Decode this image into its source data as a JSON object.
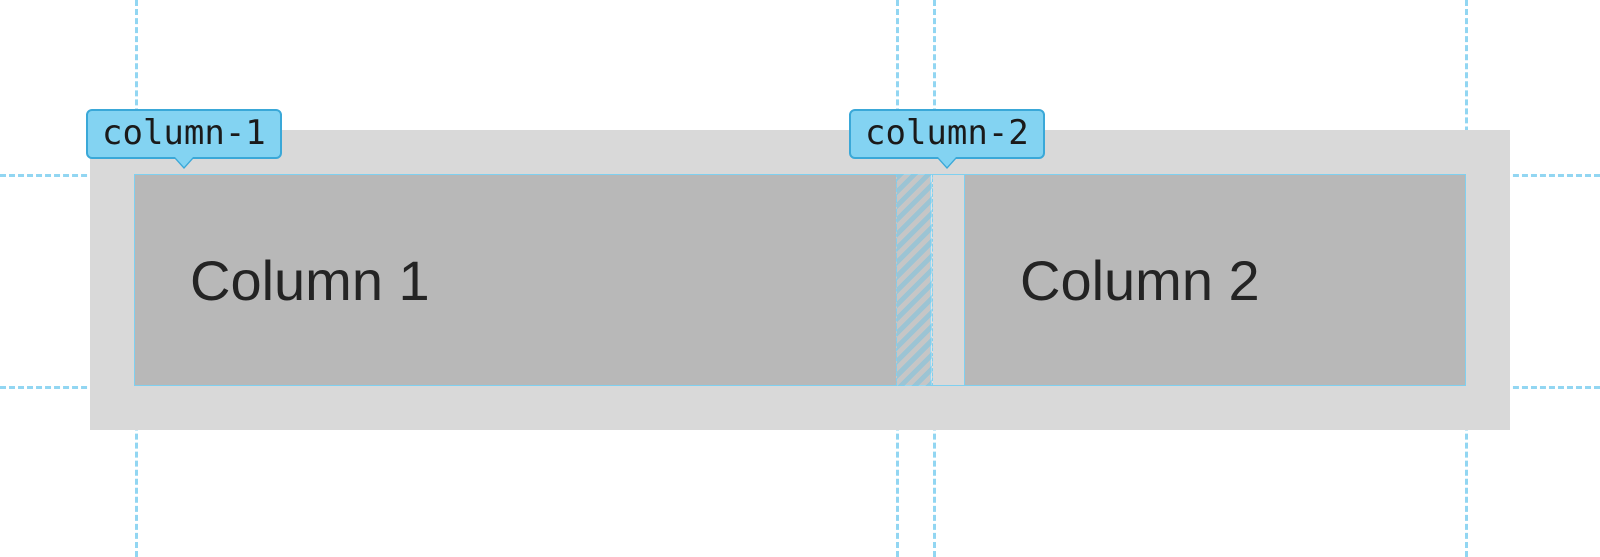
{
  "labels": {
    "column1_tag": "column-1",
    "column2_tag": "column-2"
  },
  "columns": {
    "col1_text": "Column 1",
    "col2_text": "Column 2"
  },
  "colors": {
    "guide": "#7fd0f0",
    "tag_bg": "#83d3f2",
    "tag_border": "#3aa8d8",
    "outer_bg": "#d9d9d9",
    "col_bg": "#b8b8b8"
  }
}
